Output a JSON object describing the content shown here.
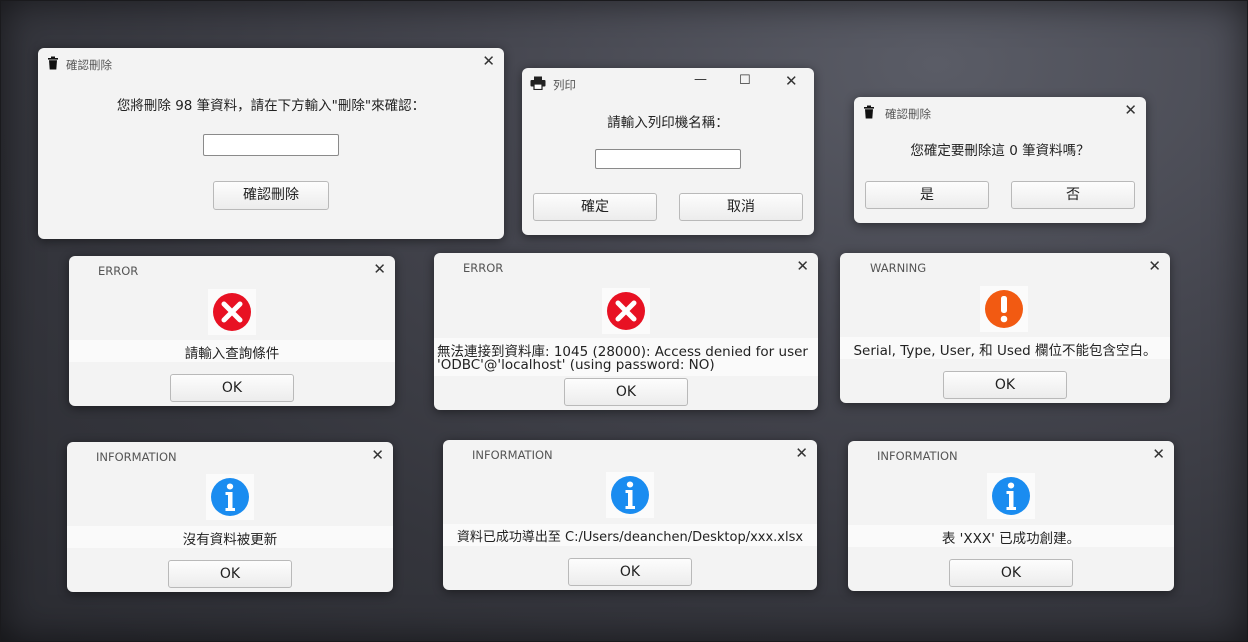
{
  "colors": {
    "error_red": "#e81123",
    "warning_orange": "#f25a12",
    "info_blue": "#1a8cf0"
  },
  "dialogs": {
    "confirm_delete_98": {
      "title": "確認刪除",
      "icon": "trash-icon",
      "message": "您將刪除 98 筆資料，請在下方輸入\"刪除\"來確認：",
      "input_value": "",
      "button": "確認刪除"
    },
    "print": {
      "title": "列印",
      "icon": "printer-icon",
      "message": "請輸入列印機名稱：",
      "input_value": "",
      "ok": "確定",
      "cancel": "取消"
    },
    "confirm_delete_0": {
      "title": "確認刪除",
      "icon": "trash-icon",
      "message": "您確定要刪除這 0 筆資料嗎？",
      "yes": "是",
      "no": "否"
    },
    "error1": {
      "title": "ERROR",
      "message": "請輸入查詢條件",
      "ok": "OK"
    },
    "error2": {
      "title": "ERROR",
      "message_line1": "無法連接到資料庫: 1045 (28000): Access denied for user",
      "message_line2": "'ODBC'@'localhost' (using password: NO)",
      "ok": "OK"
    },
    "warning": {
      "title": "WARNING",
      "message": "Serial, Type, User, 和 Used 欄位不能包含空白。",
      "ok": "OK"
    },
    "info1": {
      "title": "INFORMATION",
      "message": "沒有資料被更新",
      "ok": "OK"
    },
    "info2": {
      "title": "INFORMATION",
      "message": "資料已成功導出至 C:/Users/deanchen/Desktop/xxx.xlsx",
      "ok": "OK"
    },
    "info3": {
      "title": "INFORMATION",
      "message": "表 'XXX' 已成功創建。",
      "ok": "OK"
    }
  }
}
